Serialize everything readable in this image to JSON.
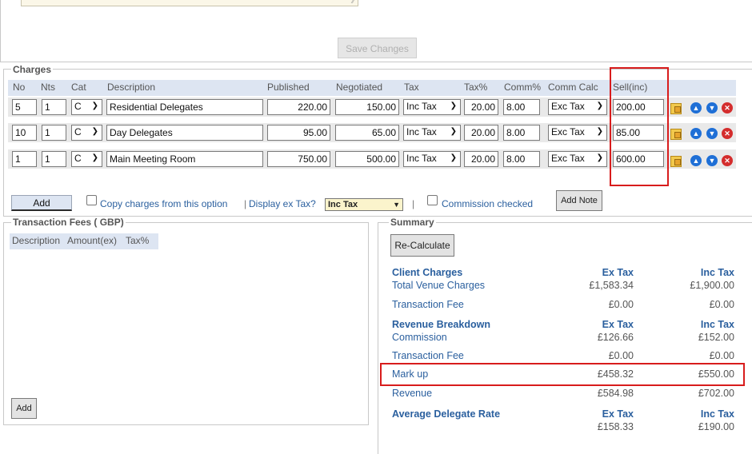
{
  "top": {
    "save_label": "Save Changes"
  },
  "charges": {
    "legend": "Charges",
    "columns": [
      "No",
      "Nts",
      "Cat",
      "Description",
      "Published",
      "Negotiated",
      "Tax",
      "Tax%",
      "Comm%",
      "Comm Calc",
      "Sell(inc)"
    ],
    "rows": [
      {
        "no": "5",
        "nts": "1",
        "cat": "C",
        "description": "Residential Delegates",
        "published": "220.00",
        "negotiated": "150.00",
        "tax": "Inc Tax",
        "tax_pct": "20.00",
        "comm_pct": "8.00",
        "comm_calc": "Exc Tax",
        "sell": "200.00"
      },
      {
        "no": "10",
        "nts": "1",
        "cat": "C",
        "description": "Day Delegates",
        "published": "95.00",
        "negotiated": "65.00",
        "tax": "Inc Tax",
        "tax_pct": "20.00",
        "comm_pct": "8.00",
        "comm_calc": "Exc Tax",
        "sell": "85.00"
      },
      {
        "no": "1",
        "nts": "1",
        "cat": "C",
        "description": "Main Meeting Room",
        "published": "750.00",
        "negotiated": "500.00",
        "tax": "Inc Tax",
        "tax_pct": "20.00",
        "comm_pct": "8.00",
        "comm_calc": "Exc Tax",
        "sell": "600.00"
      }
    ],
    "add_label": "Add",
    "copy_label": "Copy charges from this option",
    "display_label": "Display ex Tax?",
    "display_value": "Inc Tax",
    "separator": "|",
    "commission_label": "Commission checked",
    "add_note_label": "Add Note"
  },
  "transaction_fees": {
    "legend": "Transaction Fees ( GBP)",
    "columns": [
      "Description",
      "Amount(ex)",
      "Tax%"
    ],
    "add_label": "Add"
  },
  "summary": {
    "legend": "Summary",
    "recalc_label": "Re-Calculate",
    "client_charges": {
      "title": "Client Charges",
      "ex": "Ex Tax",
      "inc": "Inc Tax"
    },
    "total_venue": {
      "label": "Total Venue Charges",
      "ex": "£1,583.34",
      "inc": "£1,900.00"
    },
    "transaction_fee_1": {
      "label": "Transaction Fee",
      "ex": "£0.00",
      "inc": "£0.00"
    },
    "revenue_breakdown": {
      "title": "Revenue Breakdown",
      "ex": "Ex Tax",
      "inc": "Inc Tax"
    },
    "commission": {
      "label": "Commission",
      "ex": "£126.66",
      "inc": "£152.00"
    },
    "transaction_fee_2": {
      "label": "Transaction Fee",
      "ex": "£0.00",
      "inc": "£0.00"
    },
    "mark_up": {
      "label": "Mark up",
      "ex": "£458.32",
      "inc": "£550.00"
    },
    "revenue": {
      "label": "Revenue",
      "ex": "£584.98",
      "inc": "£702.00"
    },
    "average": {
      "title": "Average Delegate Rate",
      "ex": "Ex Tax",
      "inc": "Inc Tax",
      "ex_value": "£158.33",
      "inc_value": "£190.00"
    }
  },
  "colors": {
    "accent": "#2a5f9e",
    "highlight": "#d81c1c",
    "header_band": "#dde5f2"
  }
}
